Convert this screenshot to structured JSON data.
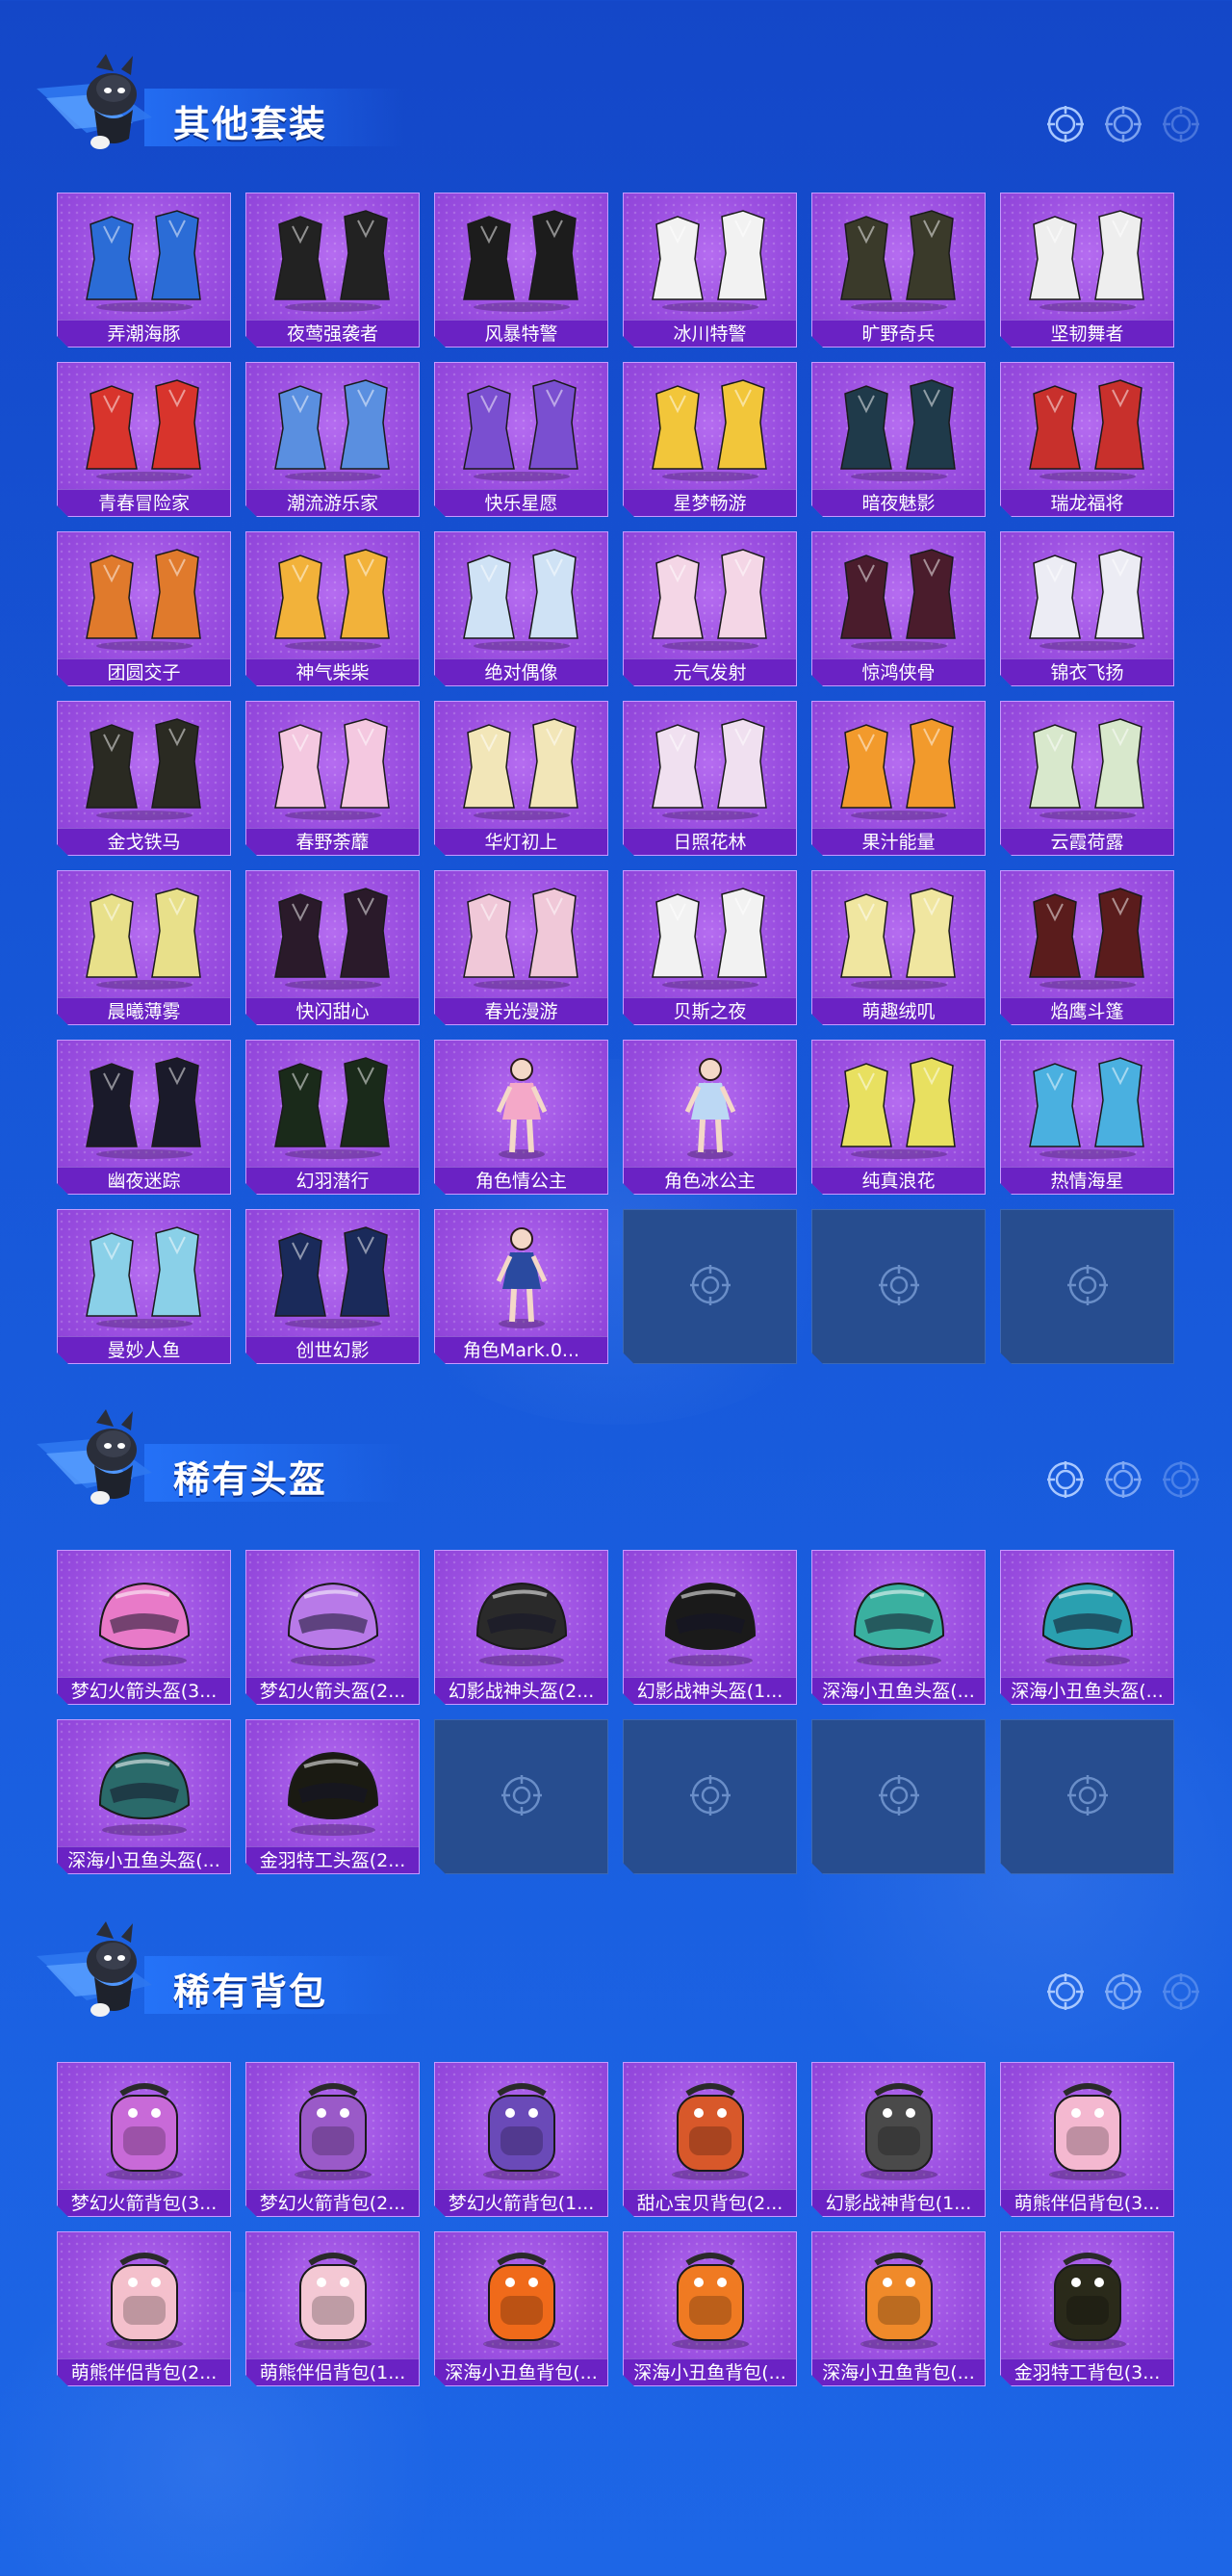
{
  "sections": [
    {
      "title": "其他套装",
      "items": [
        {
          "label": "弄潮海豚",
          "icon": "outfit-icon",
          "hue": "#2b6cd6"
        },
        {
          "label": "夜莺强袭者",
          "icon": "outfit-icon",
          "hue": "#222222"
        },
        {
          "label": "风暴特警",
          "icon": "outfit-icon",
          "hue": "#1c1c1c"
        },
        {
          "label": "冰川特警",
          "icon": "outfit-icon",
          "hue": "#f2f2f2"
        },
        {
          "label": "旷野奇兵",
          "icon": "outfit-icon",
          "hue": "#3a3a2a"
        },
        {
          "label": "坚韧舞者",
          "icon": "outfit-icon",
          "hue": "#eeeeee"
        },
        {
          "label": "青春冒险家",
          "icon": "outfit-icon",
          "hue": "#d8342c"
        },
        {
          "label": "潮流游乐家",
          "icon": "outfit-icon",
          "hue": "#5a8fe0"
        },
        {
          "label": "快乐星愿",
          "icon": "outfit-icon",
          "hue": "#7a4fd0"
        },
        {
          "label": "星梦畅游",
          "icon": "outfit-icon",
          "hue": "#f2c63a"
        },
        {
          "label": "暗夜魅影",
          "icon": "outfit-icon",
          "hue": "#1f3a4a"
        },
        {
          "label": "瑞龙福将",
          "icon": "outfit-icon",
          "hue": "#c8302c"
        },
        {
          "label": "团圆交子",
          "icon": "outfit-icon",
          "hue": "#e07a2c"
        },
        {
          "label": "神气柴柴",
          "icon": "outfit-icon",
          "hue": "#f2b23a"
        },
        {
          "label": "绝对偶像",
          "icon": "outfit-icon",
          "hue": "#cfe2f5"
        },
        {
          "label": "元气发射",
          "icon": "outfit-icon",
          "hue": "#f4d6e6"
        },
        {
          "label": "惊鸿侠骨",
          "icon": "outfit-icon",
          "hue": "#4a1c2c"
        },
        {
          "label": "锦衣飞扬",
          "icon": "outfit-icon",
          "hue": "#ececf4"
        },
        {
          "label": "金戈铁马",
          "icon": "outfit-icon",
          "hue": "#2a2a22"
        },
        {
          "label": "春野荼蘼",
          "icon": "outfit-icon",
          "hue": "#f4c8e0"
        },
        {
          "label": "华灯初上",
          "icon": "outfit-icon",
          "hue": "#f2e6b8"
        },
        {
          "label": "日照花林",
          "icon": "outfit-icon",
          "hue": "#f0e0f0"
        },
        {
          "label": "果汁能量",
          "icon": "outfit-icon",
          "hue": "#f29a2c"
        },
        {
          "label": "云霞荷露",
          "icon": "outfit-icon",
          "hue": "#d8e8cc"
        },
        {
          "label": "晨曦薄雾",
          "icon": "outfit-icon",
          "hue": "#e8e08a"
        },
        {
          "label": "快闪甜心",
          "icon": "outfit-icon",
          "hue": "#2a1a2a"
        },
        {
          "label": "春光漫游",
          "icon": "outfit-icon",
          "hue": "#f0c8d8"
        },
        {
          "label": "贝斯之夜",
          "icon": "outfit-icon",
          "hue": "#f2f2f2"
        },
        {
          "label": "萌趣绒叽",
          "icon": "outfit-icon",
          "hue": "#f0e6a0"
        },
        {
          "label": "焰鹰斗篷",
          "icon": "outfit-icon",
          "hue": "#5a1c1c"
        },
        {
          "label": "幽夜迷踪",
          "icon": "outfit-icon",
          "hue": "#1a1a2a"
        },
        {
          "label": "幻羽潜行",
          "icon": "outfit-icon",
          "hue": "#1a2a1a"
        },
        {
          "label": "角色情公主",
          "icon": "character-icon",
          "hue": "#f4a8c8"
        },
        {
          "label": "角色冰公主",
          "icon": "character-icon",
          "hue": "#bcd8f4"
        },
        {
          "label": "纯真浪花",
          "icon": "outfit-icon",
          "hue": "#e8e060"
        },
        {
          "label": "热情海星",
          "icon": "outfit-icon",
          "hue": "#4ab0e0"
        },
        {
          "label": "曼妙人鱼",
          "icon": "outfit-icon",
          "hue": "#8ad0e8"
        },
        {
          "label": "创世幻影",
          "icon": "outfit-icon",
          "hue": "#1a2a5a"
        },
        {
          "label": "角色Mark.0...",
          "icon": "character-icon",
          "hue": "#2a4aa0"
        }
      ],
      "empty_slots": 3
    },
    {
      "title": "稀有头盔",
      "items": [
        {
          "label": "梦幻火箭头盔(3...",
          "icon": "helmet-icon",
          "hue": "#e87ac8"
        },
        {
          "label": "梦幻火箭头盔(2...",
          "icon": "helmet-icon",
          "hue": "#b87ae8"
        },
        {
          "label": "幻影战神头盔(2...",
          "icon": "helmet-icon",
          "hue": "#2a2a2a"
        },
        {
          "label": "幻影战神头盔(1...",
          "icon": "helmet-icon",
          "hue": "#1a1a1a"
        },
        {
          "label": "深海小丑鱼头盔(...",
          "icon": "helmet-icon",
          "hue": "#3ab0a0"
        },
        {
          "label": "深海小丑鱼头盔(...",
          "icon": "helmet-icon",
          "hue": "#2aa0b0"
        },
        {
          "label": "深海小丑鱼头盔(...",
          "icon": "helmet-icon",
          "hue": "#2a6a6a"
        },
        {
          "label": "金羽特工头盔(2...",
          "icon": "helmet-icon",
          "hue": "#1a1a12"
        }
      ],
      "empty_slots": 4
    },
    {
      "title": "稀有背包",
      "items": [
        {
          "label": "梦幻火箭背包(3...",
          "icon": "backpack-icon",
          "hue": "#c86ad8"
        },
        {
          "label": "梦幻火箭背包(2...",
          "icon": "backpack-icon",
          "hue": "#9a5ac8"
        },
        {
          "label": "梦幻火箭背包(1...",
          "icon": "backpack-icon",
          "hue": "#6a4ab8"
        },
        {
          "label": "甜心宝贝背包(2...",
          "icon": "backpack-icon",
          "hue": "#d8582a"
        },
        {
          "label": "幻影战神背包(1...",
          "icon": "backpack-icon",
          "hue": "#4a4a4a"
        },
        {
          "label": "萌熊伴侣背包(3...",
          "icon": "backpack-icon",
          "hue": "#f4b8d0"
        },
        {
          "label": "萌熊伴侣背包(2...",
          "icon": "backpack-icon",
          "hue": "#f4c0cc"
        },
        {
          "label": "萌熊伴侣背包(1...",
          "icon": "backpack-icon",
          "hue": "#f4c8d4"
        },
        {
          "label": "深海小丑鱼背包(...",
          "icon": "backpack-icon",
          "hue": "#f06a1a"
        },
        {
          "label": "深海小丑鱼背包(...",
          "icon": "backpack-icon",
          "hue": "#f07a22"
        },
        {
          "label": "深海小丑鱼背包(...",
          "icon": "backpack-icon",
          "hue": "#f08a2a"
        },
        {
          "label": "金羽特工背包(3...",
          "icon": "backpack-icon",
          "hue": "#2a2a1a"
        }
      ],
      "empty_slots": 0
    }
  ],
  "colors": {
    "background": "#1655d6",
    "card": "#9a4ee0",
    "label_bar": "#6a22c4",
    "empty_slot": "#274d8f"
  }
}
